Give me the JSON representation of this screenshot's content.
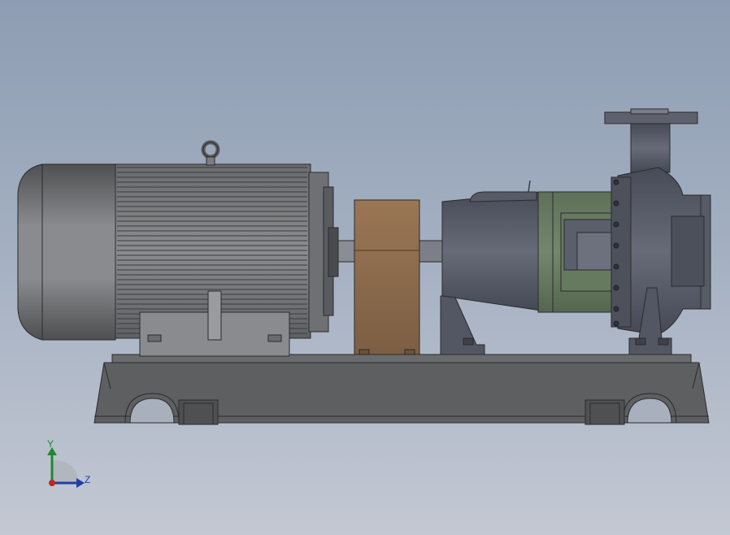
{
  "viewport": {
    "background_top": "#8e9db3",
    "background_bottom": "#c3c8d3"
  },
  "model": {
    "components": [
      "electric-motor",
      "coupling-guard",
      "bearing-frame",
      "pump-casing",
      "base-plate"
    ],
    "colors": {
      "motor_body": "#7e7f82",
      "coupling_guard": "#8b6a4c",
      "bearing_adapter": "#6a7d66",
      "pump_body": "#5b5f6c",
      "base_plate": "#5e5f61"
    }
  },
  "triad": {
    "y_label": "Y",
    "z_label": "Z",
    "y_color": "#1e8a2e",
    "z_color": "#1f3fa6",
    "x_color": "#c0281e"
  }
}
